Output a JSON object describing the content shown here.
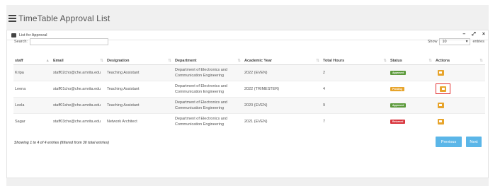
{
  "page": {
    "title": "TimeTable Approval List"
  },
  "panel": {
    "title": "List for Approval",
    "tools": {
      "minimize": "–",
      "expand": "⤢",
      "close": "×"
    }
  },
  "search": {
    "label": "Search:",
    "value": ""
  },
  "length": {
    "prefix": "Show",
    "value": "10",
    "suffix": "entries"
  },
  "table": {
    "columns": [
      "staff",
      "Email",
      "Designation",
      "Department",
      "Academic Year",
      "Total Hours",
      "Status",
      "Actions"
    ],
    "rows": [
      {
        "staff": "Kripa",
        "email": "staff02cho@che.amrita.edu",
        "designation": "Teaching Assistant",
        "department": "Department of Electronics and Communication Engineering",
        "year": "2022 (EVEN)",
        "hours": "2",
        "status": "Approved",
        "status_color": "#5c9a3b",
        "selected": false
      },
      {
        "staff": "Leena",
        "email": "staff01cho@che.amrita.edu",
        "designation": "Teaching Assistant",
        "department": "Department of Electronics and Communication Engineering",
        "year": "2022 (TRIMESTER)",
        "hours": "4",
        "status": "Pending",
        "status_color": "#e7a42b",
        "selected": true
      },
      {
        "staff": "Leela",
        "email": "staff01she@che.amrita.edu",
        "designation": "Teaching Assistant",
        "department": "Department of Electronics and Communication Engineering",
        "year": "2020 (EVEN)",
        "hours": "9",
        "status": "Approved",
        "status_color": "#5c9a3b",
        "selected": false
      },
      {
        "staff": "Sagar",
        "email": "staff03che@che.amrita.edu",
        "designation": "Network Architect",
        "department": "Department of Electronics and Communication Engineering",
        "year": "2021 (EVEN)",
        "hours": "7",
        "status": "Returned",
        "status_color": "#d9363e",
        "selected": false
      }
    ]
  },
  "info": "Showing 1 to 4 of 4 entries (filtered from 30 total entries)",
  "pager": {
    "previous": "Previous",
    "next": "Next"
  },
  "colors": {
    "accent": "#5bb6e8",
    "action": "#e7a42b"
  }
}
